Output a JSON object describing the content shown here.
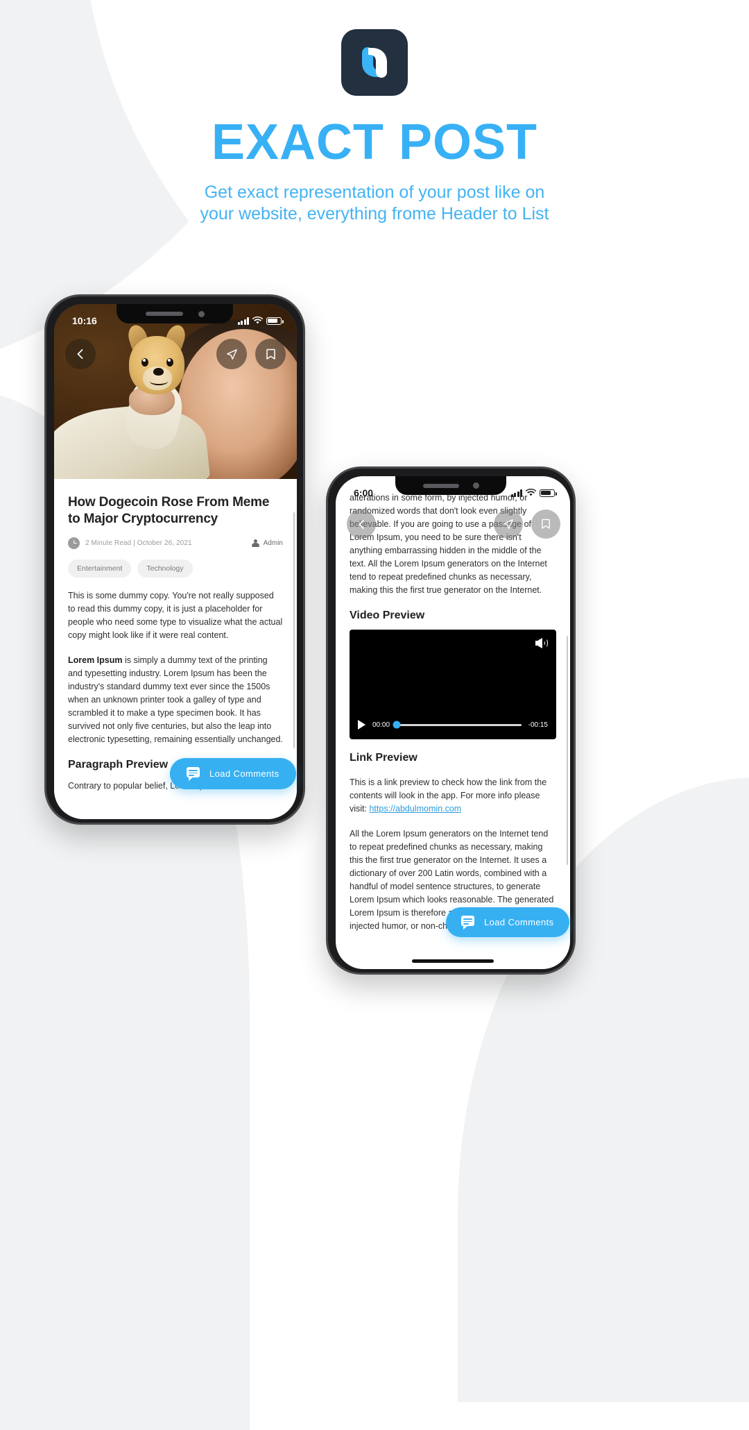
{
  "header": {
    "logo_icon": "app-logo-h-mark",
    "title": "EXACT POST",
    "subtitle_line1": "Get exact representation of your post like on",
    "subtitle_line2": "your website, everything frome Header to List",
    "accent_color": "#38b0f5",
    "subtitle_color": "#44b3f2"
  },
  "phone1": {
    "statusbar": {
      "time": "10:16"
    },
    "hero": {
      "image_alt": "doge-elon-meme-photo",
      "back_icon": "chevron-left-icon",
      "share_icon": "send-icon",
      "bookmark_icon": "bookmark-icon"
    },
    "article": {
      "title": "How Dogecoin Rose From Meme to Major Cryptocurrency",
      "clock_icon": "clock-icon",
      "read_meta": "2 Minute Read | October 26, 2021",
      "person_icon": "person-icon",
      "author": "Admin",
      "tags": [
        "Entertainment",
        "Technology"
      ],
      "para1": "This is some dummy copy. You're not really supposed to read this dummy copy, it is just a placeholder for people who need some type to visualize what the actual copy might look like if it were real content.",
      "para2_bold": "Lorem Ipsum",
      "para2": " is simply a dummy text of the printing and typesetting industry. Lorem Ipsum has been the industry's standard dummy text ever since the 1500s when an unknown printer took a galley of type and scrambled it to make a type specimen book. It has survived not only five centuries, but also the leap into electronic typesetting, remaining essentially unchanged.",
      "section_heading": "Paragraph Preview",
      "para3": "Contrary to popular belief, Lorem Ipsum is not"
    },
    "load_comments": {
      "label": "Load Comments",
      "icon": "chat-bubble-icon",
      "color": "#37b0f2"
    }
  },
  "phone2": {
    "statusbar": {
      "time": "6:00"
    },
    "hero": {
      "back_icon": "chevron-left-icon",
      "share_icon": "send-icon",
      "bookmark_icon": "bookmark-icon"
    },
    "article": {
      "para_top": "alterations in some form, by injected humor, or randomized words that don't look even slightly believable. If you are going to use a passage of Lorem Ipsum, you need to be sure there isn't anything embarrassing hidden in the middle of the text. All the Lorem Ipsum generators on the Internet tend to repeat predefined chunks as necessary, making this the first true generator on the Internet.",
      "video_heading": "Video Preview",
      "video": {
        "volume_icon": "volume-icon",
        "play_icon": "play-icon",
        "current_time": "00:00",
        "remaining_time": "-00:15",
        "progress_percent": 1
      },
      "link_heading": "Link Preview",
      "link_para_before": "This is a link preview to check how the link from the contents will look in the app. For more info please visit: ",
      "link_text": "https://abdulmomin.com",
      "para_bottom": "All the Lorem Ipsum generators on the Internet tend to repeat predefined chunks as necessary, making this the first true generator on the Internet. It uses a dictionary of over 200 Latin words, combined with a handful of model sentence structures, to generate Lorem Ipsum which looks reasonable. The generated Lorem Ipsum is therefore always free from repetition, injected humor, or non-characteristic words etc."
    },
    "load_comments": {
      "label": "Load Comments",
      "icon": "chat-bubble-icon",
      "color": "#37b0f2"
    }
  }
}
